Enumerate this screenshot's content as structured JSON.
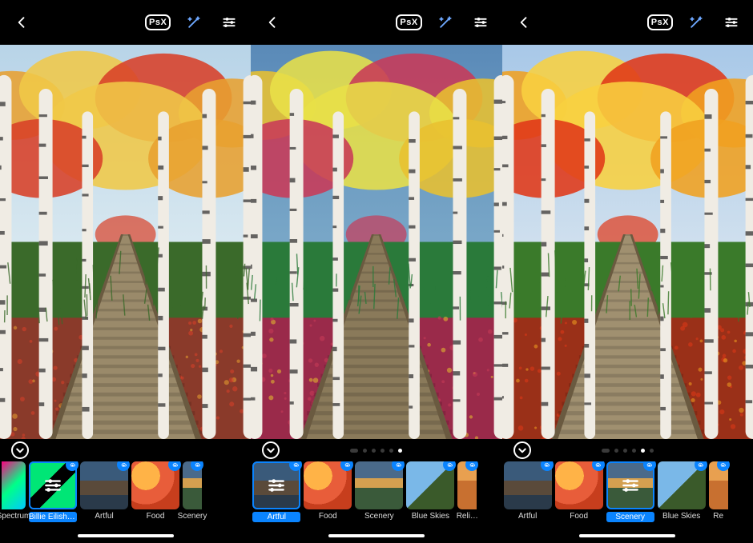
{
  "panels": [
    {
      "toolbar": {
        "psx": "PsX"
      },
      "page_indicator": {
        "type": "none"
      },
      "selected_filter": "Billie Eilish Bl…",
      "image_variant": "natural",
      "filters": [
        {
          "key": "spectrum",
          "label": "Spectrum",
          "badge": false,
          "partial_left": true
        },
        {
          "key": "billie",
          "label": "Billie Eilish Bl…",
          "badge": true,
          "selected": true,
          "sliders": true
        },
        {
          "key": "artful",
          "label": "Artful",
          "badge": true
        },
        {
          "key": "food",
          "label": "Food",
          "badge": true
        },
        {
          "key": "scenery",
          "label": "Scenery",
          "badge": true,
          "partial_right": true
        }
      ]
    },
    {
      "toolbar": {
        "psx": "PsX"
      },
      "page_indicator": {
        "type": "dots",
        "count": 5,
        "active": 4
      },
      "selected_filter": "Artful",
      "image_variant": "painted",
      "filters": [
        {
          "key": "artful",
          "label": "Artful",
          "badge": true,
          "selected": true,
          "sliders": true
        },
        {
          "key": "food",
          "label": "Food",
          "badge": true
        },
        {
          "key": "scenery",
          "label": "Scenery",
          "badge": true
        },
        {
          "key": "blueskies",
          "label": "Blue Skies",
          "badge": true
        },
        {
          "key": "reli",
          "label": "Reli…",
          "badge": true,
          "partial_right": true
        }
      ]
    },
    {
      "toolbar": {
        "psx": "PsX"
      },
      "page_indicator": {
        "type": "dots",
        "count": 5,
        "active": 3
      },
      "selected_filter": "Scenery",
      "image_variant": "saturated",
      "filters": [
        {
          "key": "artful",
          "label": "Artful",
          "badge": true
        },
        {
          "key": "food",
          "label": "Food",
          "badge": true
        },
        {
          "key": "scenery",
          "label": "Scenery",
          "badge": true,
          "selected": true,
          "sliders": true
        },
        {
          "key": "blueskies",
          "label": "Blue Skies",
          "badge": true
        },
        {
          "key": "reli",
          "label": "Re",
          "badge": true,
          "partial_right": true
        }
      ]
    }
  ]
}
